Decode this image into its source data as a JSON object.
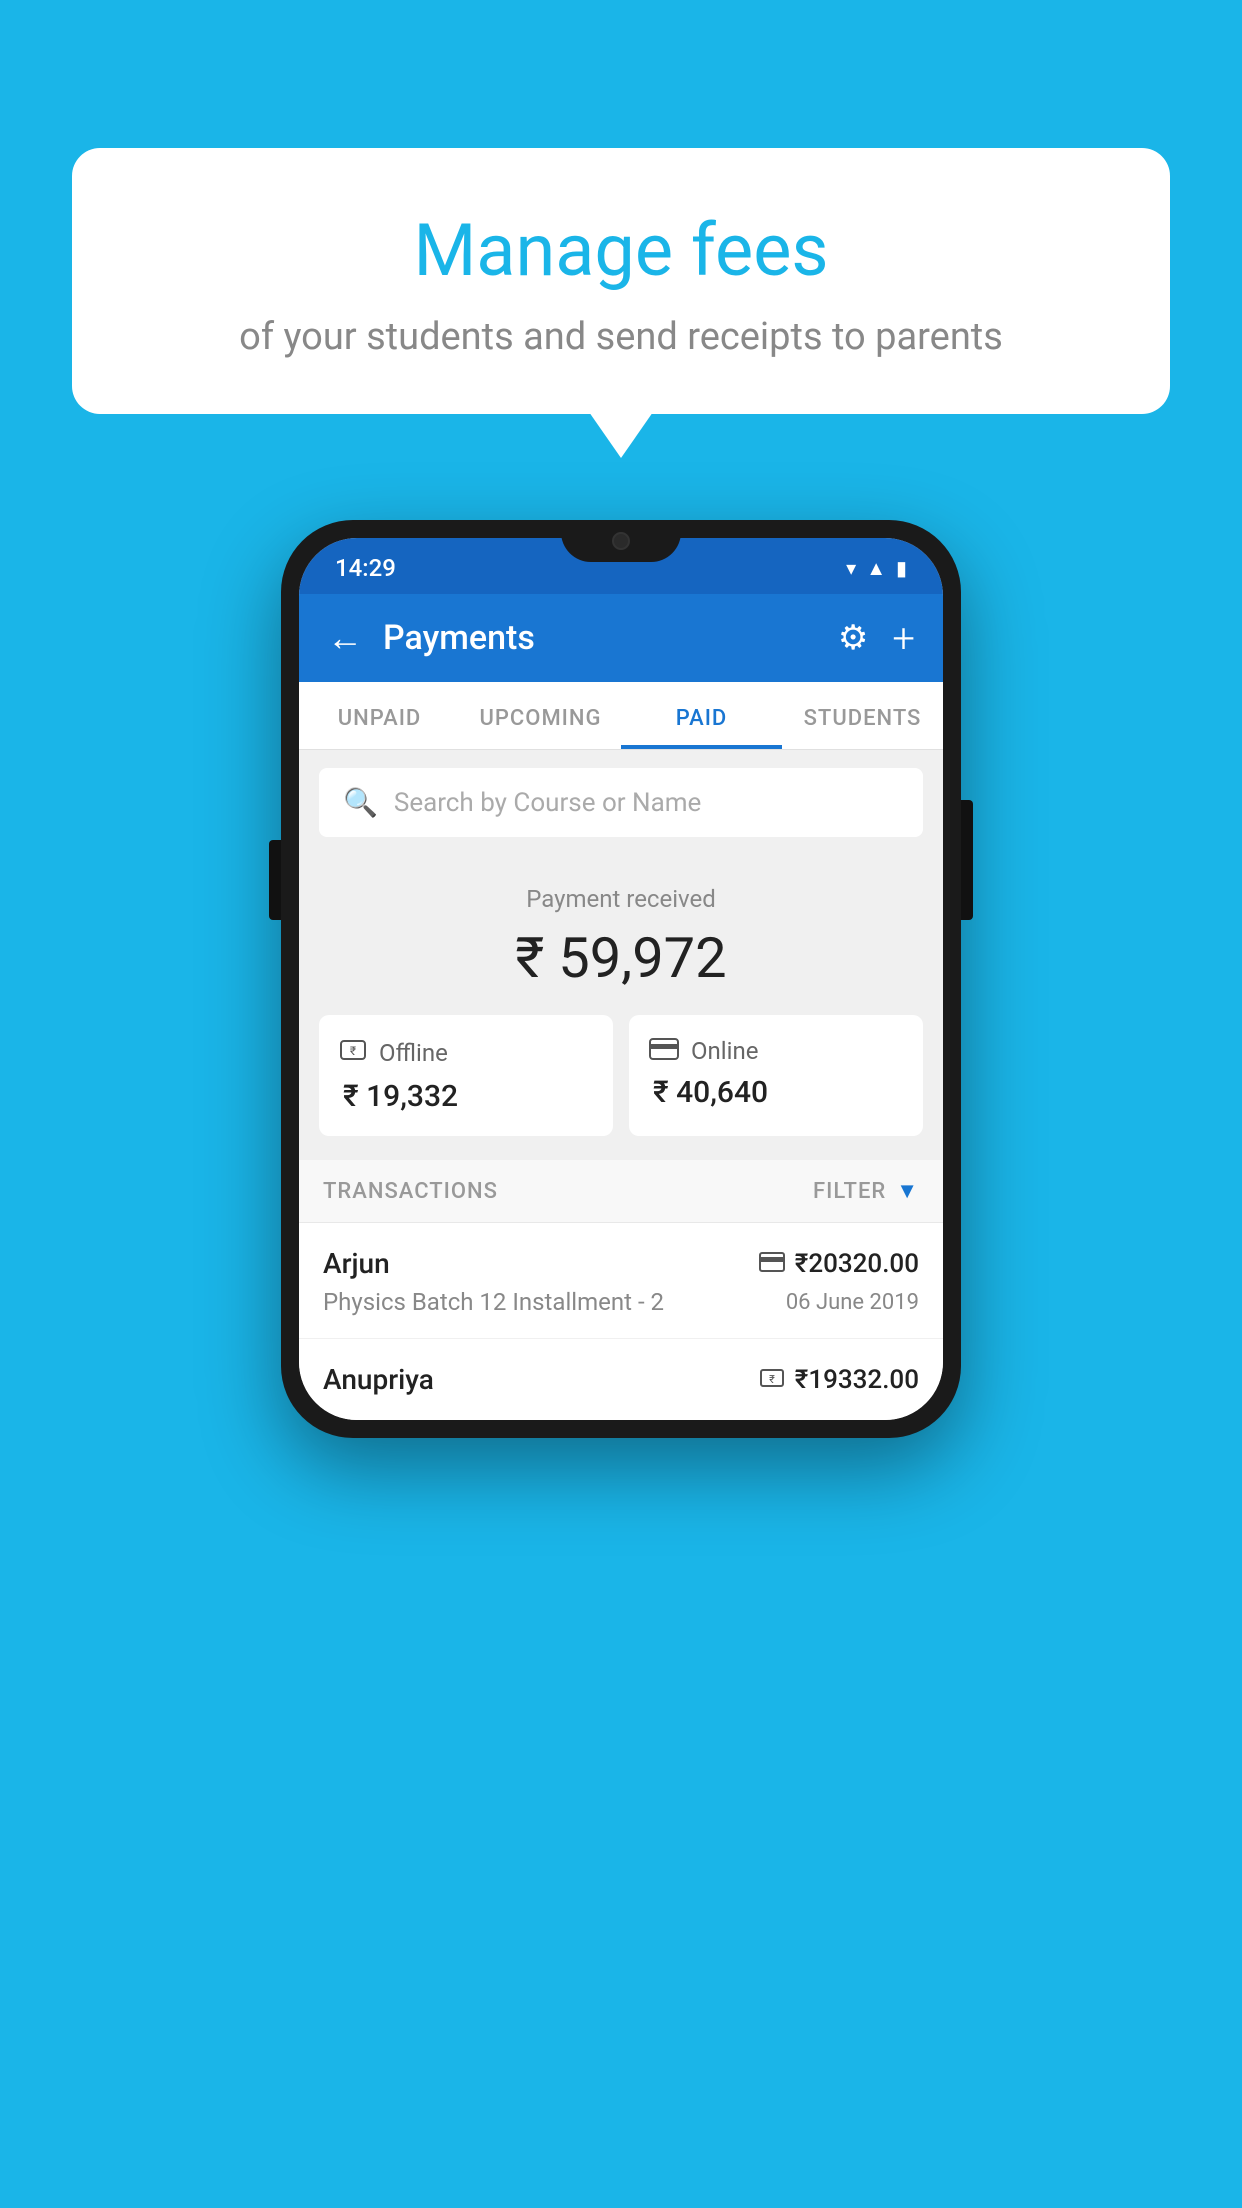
{
  "background_color": "#1ab5e8",
  "speech_bubble": {
    "title": "Manage fees",
    "subtitle": "of your students and send receipts to parents"
  },
  "phone": {
    "status_bar": {
      "time": "14:29",
      "wifi": "▾",
      "signal": "▲",
      "battery": "▮"
    },
    "header": {
      "title": "Payments",
      "back_label": "←",
      "gear_label": "⚙",
      "plus_label": "+"
    },
    "tabs": [
      {
        "label": "UNPAID",
        "active": false
      },
      {
        "label": "UPCOMING",
        "active": false
      },
      {
        "label": "PAID",
        "active": true
      },
      {
        "label": "STUDENTS",
        "active": false
      }
    ],
    "search": {
      "placeholder": "Search by Course or Name"
    },
    "payment_summary": {
      "label": "Payment received",
      "total": "₹ 59,972",
      "offline_label": "Offline",
      "offline_amount": "₹ 19,332",
      "online_label": "Online",
      "online_amount": "₹ 40,640"
    },
    "transactions": {
      "header_label": "TRANSACTIONS",
      "filter_label": "FILTER",
      "rows": [
        {
          "name": "Arjun",
          "course": "Physics Batch 12 Installment - 2",
          "amount": "₹20320.00",
          "date": "06 June 2019",
          "type": "online"
        },
        {
          "name": "Anupriya",
          "course": "",
          "amount": "₹19332.00",
          "date": "",
          "type": "offline"
        }
      ]
    }
  }
}
